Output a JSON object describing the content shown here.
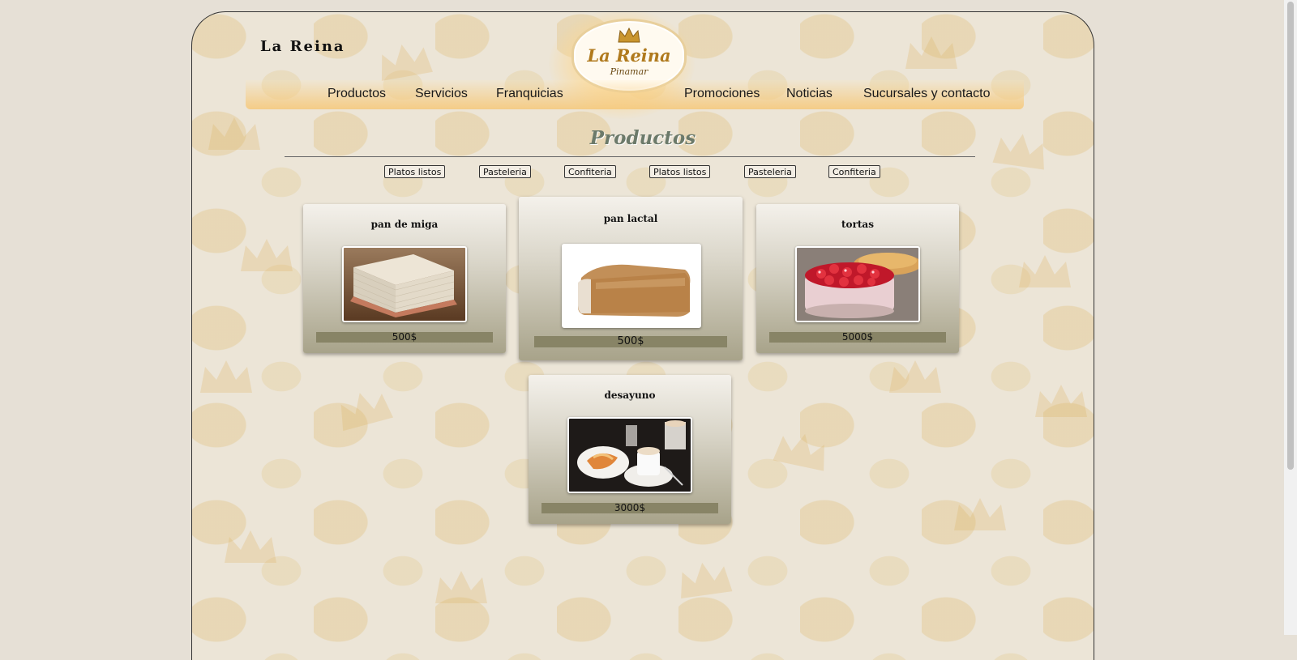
{
  "site": {
    "name": "La Reina"
  },
  "logo": {
    "name": "La Reina",
    "subtitle": "Pinamar",
    "icon": "crown-icon"
  },
  "nav": {
    "items": [
      {
        "label": "Productos"
      },
      {
        "label": "Servicios"
      },
      {
        "label": "Franquicias"
      },
      {
        "label": "Promociones"
      },
      {
        "label": "Noticias"
      },
      {
        "label": "Sucursales y contacto"
      }
    ]
  },
  "section": {
    "title": "Productos"
  },
  "filters": [
    {
      "label": "Platos listos"
    },
    {
      "label": "Pasteleria"
    },
    {
      "label": "Confiteria"
    },
    {
      "label": "Platos listos"
    },
    {
      "label": "Pasteleria"
    },
    {
      "label": "Confiteria"
    }
  ],
  "products": [
    {
      "name": "pan de miga",
      "price": "500$",
      "image": "bread-stack-image"
    },
    {
      "name": "pan lactal",
      "price": "500$",
      "image": "loaf-image"
    },
    {
      "name": "tortas",
      "price": "5000$",
      "image": "cake-image"
    },
    {
      "name": "desayuno",
      "price": "3000$",
      "image": "breakfast-image"
    }
  ],
  "colors": {
    "background": "#e6e0d6",
    "page": "#ece5d7",
    "gold": "#f6c878",
    "title": "#6c7a6a",
    "price_bar": "#888466"
  }
}
